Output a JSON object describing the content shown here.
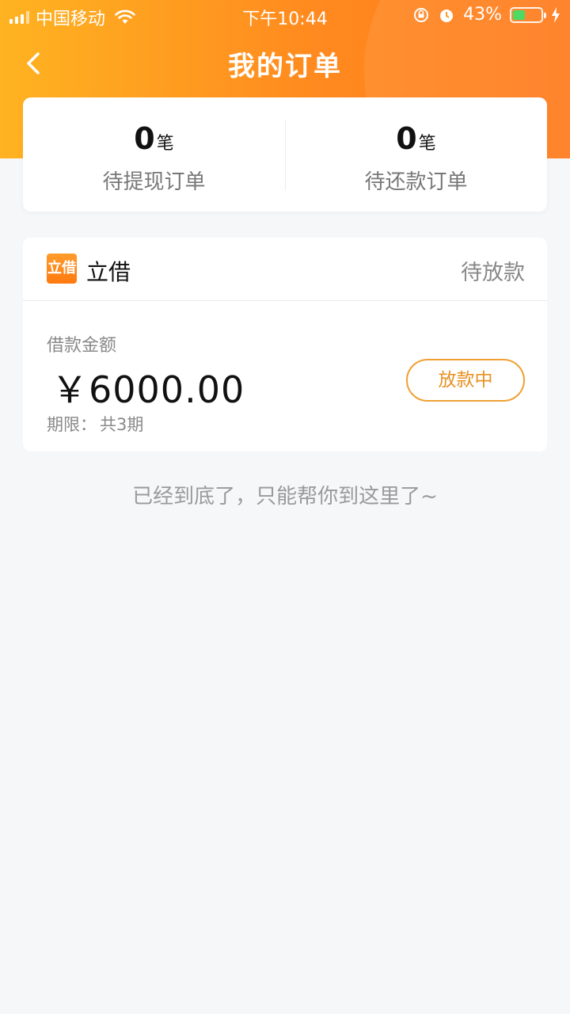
{
  "status_bar": {
    "carrier": "中国移动",
    "time": "下午10:44",
    "battery_percent": "43%",
    "battery_level": 0.43
  },
  "nav": {
    "title": "我的订单"
  },
  "stats": {
    "pending_withdraw": {
      "count": "0",
      "unit": "笔",
      "label": "待提现订单"
    },
    "pending_repay": {
      "count": "0",
      "unit": "笔",
      "label": "待还款订单"
    }
  },
  "order": {
    "brand_logo_text": "立借",
    "brand_name": "立借",
    "status": "待放款",
    "amount_label": "借款金额",
    "amount": "￥6000.00",
    "term_label": "期限：",
    "term_value": "共3期",
    "action_label": "放款中"
  },
  "end_note": "已经到底了，只能帮你到这里了~",
  "colors": {
    "accent": "#ff8a1f",
    "button_border": "#f0a033",
    "battery": "#4cd964"
  }
}
